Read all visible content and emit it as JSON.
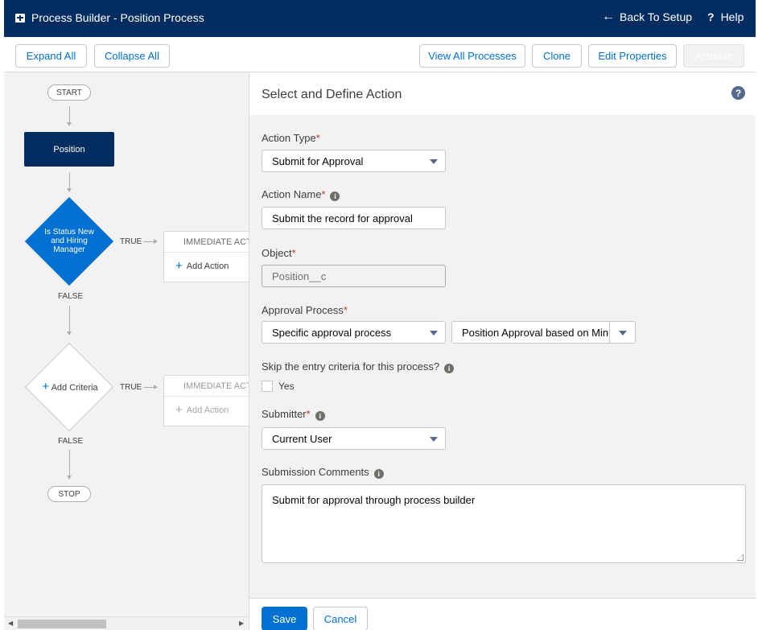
{
  "header": {
    "title": "Process Builder - Position Process",
    "back_label": "Back To Setup",
    "help_label": "Help"
  },
  "toolbar": {
    "expand_all": "Expand All",
    "collapse_all": "Collapse All",
    "view_all_processes": "View All Processes",
    "clone": "Clone",
    "edit_properties": "Edit Properties",
    "activate": "Activate"
  },
  "canvas": {
    "start_label": "START",
    "object_node": "Position",
    "criteria_1": "Is Status New and Hiring Manager",
    "true_label": "TRUE",
    "false_label": "FALSE",
    "immediate_actions": "IMMEDIATE ACTIONS",
    "add_action": "Add Action",
    "add_criteria": "Add Criteria",
    "stop_label": "STOP"
  },
  "panel": {
    "title": "Select and Define Action",
    "action_type_label": "Action Type",
    "action_type_value": "Submit for Approval",
    "action_name_label": "Action Name",
    "action_name_value": "Submit the record for approval",
    "object_label": "Object",
    "object_value": "Position__c",
    "approval_process_label": "Approval Process",
    "approval_process_value": "Specific approval process",
    "approval_process_specific": "Position Approval based on Min",
    "skip_label": "Skip the entry criteria for this process?",
    "skip_option": "Yes",
    "submitter_label": "Submitter",
    "submitter_value": "Current User",
    "comments_label": "Submission Comments",
    "comments_value": "Submit for approval through process builder",
    "required_mark": "*",
    "save": "Save",
    "cancel": "Cancel"
  },
  "colors": {
    "header_bg": "#032d60",
    "brand_blue": "#0070d2",
    "required": "#c23934"
  }
}
